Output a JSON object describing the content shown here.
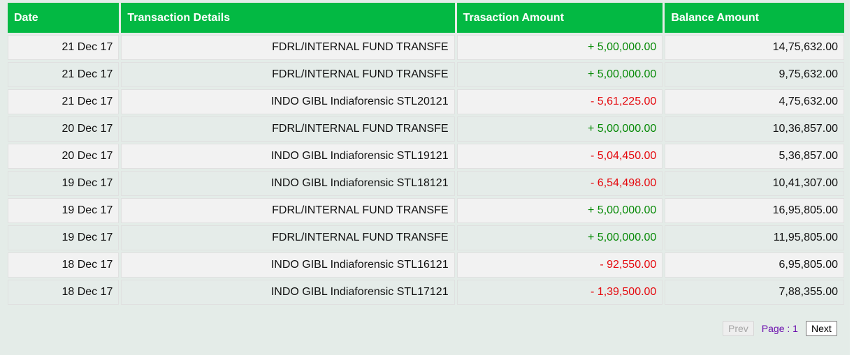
{
  "table": {
    "headers": [
      "Date",
      "Transaction Details",
      "Trasaction Amount",
      "Balance Amount"
    ],
    "rows": [
      {
        "date": "21 Dec 17",
        "details": "FDRL/INTERNAL FUND TRANSFE",
        "amount": "+ 5,00,000.00",
        "type": "credit",
        "balance": "14,75,632.00"
      },
      {
        "date": "21 Dec 17",
        "details": "FDRL/INTERNAL FUND TRANSFE",
        "amount": "+ 5,00,000.00",
        "type": "credit",
        "balance": "9,75,632.00"
      },
      {
        "date": "21 Dec 17",
        "details": "INDO GIBL Indiaforensic STL20121",
        "amount": "- 5,61,225.00",
        "type": "debit",
        "balance": "4,75,632.00"
      },
      {
        "date": "20 Dec 17",
        "details": "FDRL/INTERNAL FUND TRANSFE",
        "amount": "+ 5,00,000.00",
        "type": "credit",
        "balance": "10,36,857.00"
      },
      {
        "date": "20 Dec 17",
        "details": "INDO GIBL Indiaforensic STL19121",
        "amount": "- 5,04,450.00",
        "type": "debit",
        "balance": "5,36,857.00"
      },
      {
        "date": "19 Dec 17",
        "details": "INDO GIBL Indiaforensic STL18121",
        "amount": "- 6,54,498.00",
        "type": "debit",
        "balance": "10,41,307.00"
      },
      {
        "date": "19 Dec 17",
        "details": "FDRL/INTERNAL FUND TRANSFE",
        "amount": "+ 5,00,000.00",
        "type": "credit",
        "balance": "16,95,805.00"
      },
      {
        "date": "19 Dec 17",
        "details": "FDRL/INTERNAL FUND TRANSFE",
        "amount": "+ 5,00,000.00",
        "type": "credit",
        "balance": "11,95,805.00"
      },
      {
        "date": "18 Dec 17",
        "details": "INDO GIBL Indiaforensic STL16121",
        "amount": "- 92,550.00",
        "type": "debit",
        "balance": "6,95,805.00"
      },
      {
        "date": "18 Dec 17",
        "details": "INDO GIBL Indiaforensic STL17121",
        "amount": "- 1,39,500.00",
        "type": "debit",
        "balance": "7,88,355.00"
      }
    ]
  },
  "pager": {
    "prev_label": "Prev",
    "page_label": "Page : 1",
    "next_label": "Next"
  },
  "colors": {
    "header": "#03b943",
    "credit": "#078a07",
    "debit": "#e5090e"
  }
}
